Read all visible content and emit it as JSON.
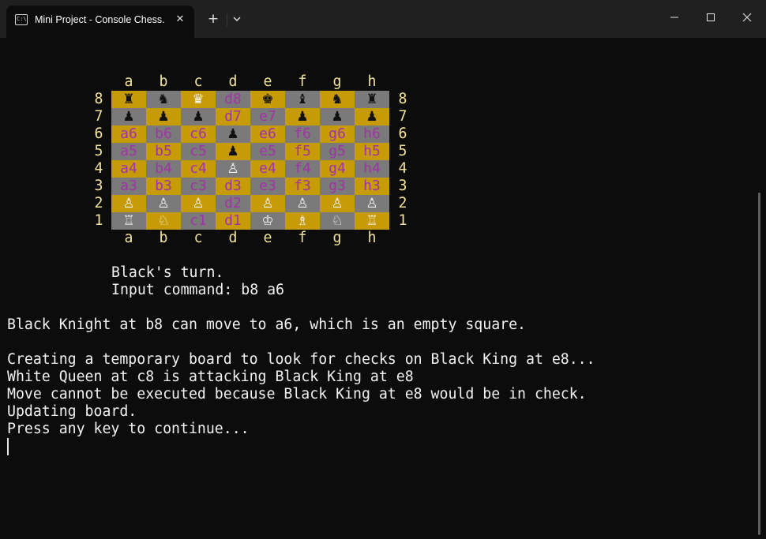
{
  "window": {
    "tab_title": "Mini Project - Console Chess.exe",
    "icon_glyph": "C:\\",
    "tab_icon": "terminal-icon",
    "controls": [
      "minimize-icon",
      "maximize-icon",
      "close-icon"
    ]
  },
  "board": {
    "files": [
      "a",
      "b",
      "c",
      "d",
      "e",
      "f",
      "g",
      "h"
    ],
    "ranks": [
      "8",
      "7",
      "6",
      "5",
      "4",
      "3",
      "2",
      "1"
    ],
    "colors": {
      "light": "#c79a08",
      "dark": "#7a7a7a",
      "label": "#a033a8",
      "coord": "#f3e39a"
    },
    "squares": [
      [
        {
          "t": "♜",
          "c": "black"
        },
        {
          "t": "♞",
          "c": "black"
        },
        {
          "t": "♛",
          "c": "white"
        },
        {
          "t": "d8"
        },
        {
          "t": "♚",
          "c": "black"
        },
        {
          "t": "♝",
          "c": "black"
        },
        {
          "t": "♞",
          "c": "black"
        },
        {
          "t": "♜",
          "c": "black"
        }
      ],
      [
        {
          "t": "♟",
          "c": "black"
        },
        {
          "t": "♟",
          "c": "black"
        },
        {
          "t": "♟",
          "c": "black"
        },
        {
          "t": "d7"
        },
        {
          "t": "e7"
        },
        {
          "t": "♟",
          "c": "black"
        },
        {
          "t": "♟",
          "c": "black"
        },
        {
          "t": "♟",
          "c": "black"
        }
      ],
      [
        {
          "t": "a6"
        },
        {
          "t": "b6"
        },
        {
          "t": "c6"
        },
        {
          "t": "♟",
          "c": "black"
        },
        {
          "t": "e6"
        },
        {
          "t": "f6"
        },
        {
          "t": "g6"
        },
        {
          "t": "h6"
        }
      ],
      [
        {
          "t": "a5"
        },
        {
          "t": "b5"
        },
        {
          "t": "c5"
        },
        {
          "t": "♟",
          "c": "black"
        },
        {
          "t": "e5"
        },
        {
          "t": "f5"
        },
        {
          "t": "g5"
        },
        {
          "t": "h5"
        }
      ],
      [
        {
          "t": "a4"
        },
        {
          "t": "b4"
        },
        {
          "t": "c4"
        },
        {
          "t": "♙",
          "c": "white"
        },
        {
          "t": "e4"
        },
        {
          "t": "f4"
        },
        {
          "t": "g4"
        },
        {
          "t": "h4"
        }
      ],
      [
        {
          "t": "a3"
        },
        {
          "t": "b3"
        },
        {
          "t": "c3"
        },
        {
          "t": "d3"
        },
        {
          "t": "e3"
        },
        {
          "t": "f3"
        },
        {
          "t": "g3"
        },
        {
          "t": "h3"
        }
      ],
      [
        {
          "t": "♙",
          "c": "white"
        },
        {
          "t": "♙",
          "c": "white"
        },
        {
          "t": "♙",
          "c": "white"
        },
        {
          "t": "d2"
        },
        {
          "t": "♙",
          "c": "white"
        },
        {
          "t": "♙",
          "c": "white"
        },
        {
          "t": "♙",
          "c": "white"
        },
        {
          "t": "♙",
          "c": "white"
        }
      ],
      [
        {
          "t": "♖",
          "c": "white"
        },
        {
          "t": "♘",
          "c": "white"
        },
        {
          "t": "c1"
        },
        {
          "t": "d1"
        },
        {
          "t": "♔",
          "c": "white"
        },
        {
          "t": "♗",
          "c": "white"
        },
        {
          "t": "♘",
          "c": "white"
        },
        {
          "t": "♖",
          "c": "white"
        }
      ]
    ]
  },
  "console": {
    "turn_line": "Black's turn.",
    "input_line": "Input command: b8 a6",
    "output_lines": [
      "Black Knight at b8 can move to a6, which is an empty square.",
      "",
      "Creating a temporary board to look for checks on Black King at e8...",
      "White Queen at c8 is attacking Black King at e8",
      "Move cannot be executed because Black King at e8 would be in check.",
      "Updating board.",
      "Press any key to continue..."
    ]
  }
}
